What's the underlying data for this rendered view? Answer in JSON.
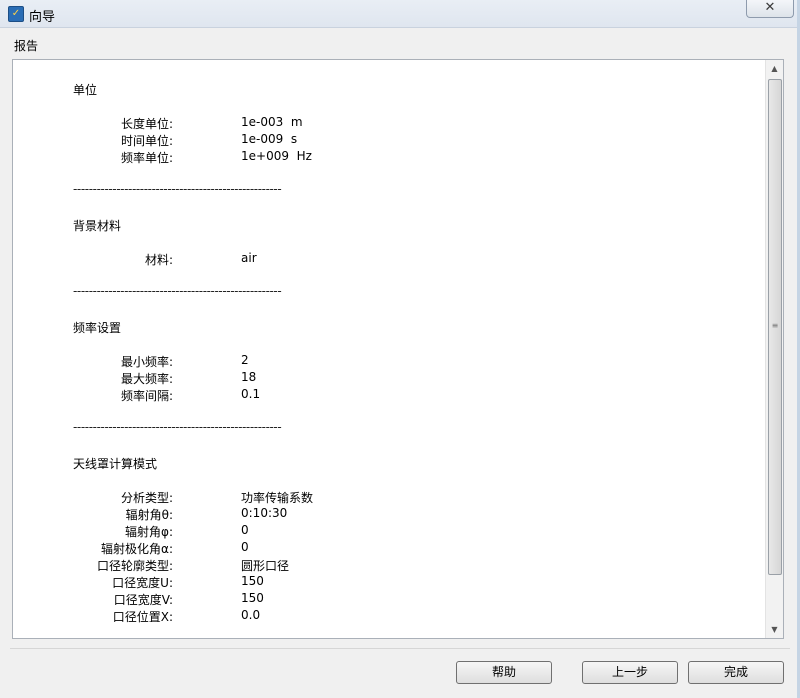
{
  "window": {
    "title": "向导",
    "close_glyph": "✕"
  },
  "section_label": "报告",
  "separator": "-----------------------------------------------------",
  "report": {
    "units": {
      "heading": "单位",
      "rows": [
        {
          "label": "长度单位:",
          "value": "1e-003  m"
        },
        {
          "label": "时间单位:",
          "value": "1e-009  s"
        },
        {
          "label": "频率单位:",
          "value": "1e+009  Hz"
        }
      ]
    },
    "background": {
      "heading": "背景材料",
      "rows": [
        {
          "label": "材料:",
          "value": "air"
        }
      ]
    },
    "frequency": {
      "heading": "频率设置",
      "rows": [
        {
          "label": "最小频率:",
          "value": "2"
        },
        {
          "label": "最大频率:",
          "value": "18"
        },
        {
          "label": "频率间隔:",
          "value": "0.1"
        }
      ]
    },
    "radome": {
      "heading": "天线罩计算模式",
      "rows": [
        {
          "label": "分析类型:",
          "value": "功率传输系数"
        },
        {
          "label": "辐射角θ:",
          "value": "0:10:30"
        },
        {
          "label": "辐射角φ:",
          "value": "0"
        },
        {
          "label": "辐射极化角α:",
          "value": "0"
        },
        {
          "label": "口径轮廓类型:",
          "value": "圆形口径"
        },
        {
          "label": "口径宽度U:",
          "value": "150"
        },
        {
          "label": "口径宽度V:",
          "value": "150"
        },
        {
          "label": "口径位置X:",
          "value": "0.0"
        }
      ]
    }
  },
  "buttons": {
    "help": "帮助",
    "back": "上一步",
    "finish": "完成"
  },
  "scrollbar": {
    "up_glyph": "▲",
    "down_glyph": "▼",
    "grip_glyph": "≡"
  }
}
